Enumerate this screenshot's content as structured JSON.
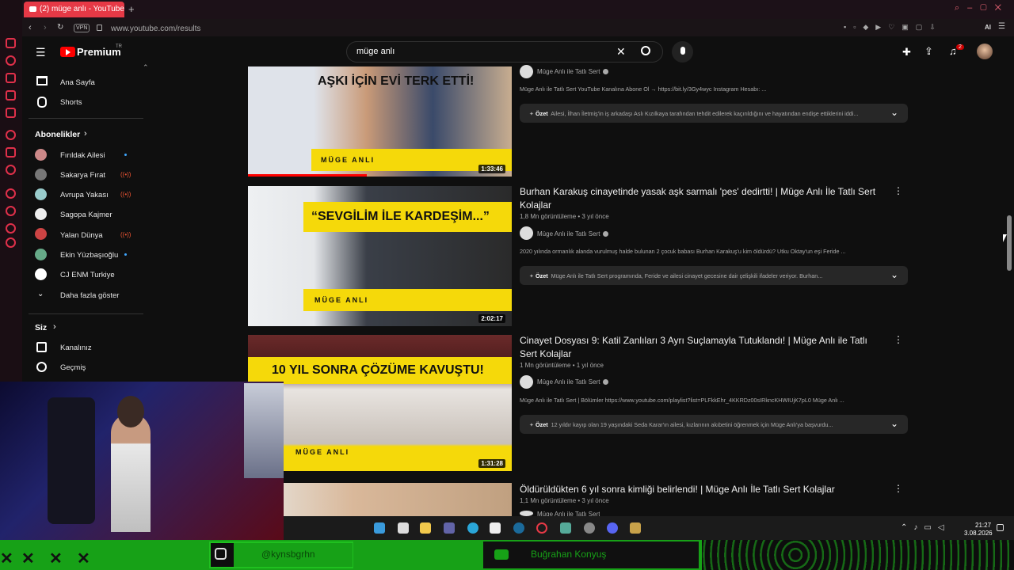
{
  "browser": {
    "tab_title": "(2) müge anlı - YouTube",
    "url": "www.youtube.com/results",
    "vpn": "VPN",
    "ai": "AI"
  },
  "yt": {
    "logo": "Premium",
    "logo_sup": "TR",
    "search_query": "müge anlı",
    "notif_count": "2"
  },
  "sidebar": {
    "nav": [
      {
        "label": "Ana Sayfa"
      },
      {
        "label": "Shorts"
      }
    ],
    "subs_title": "Abonelikler",
    "subs": [
      {
        "label": "Fırıldak Ailesi"
      },
      {
        "label": "Sakarya Fırat"
      },
      {
        "label": "Avrupa Yakası"
      },
      {
        "label": "Sagopa Kajmer"
      },
      {
        "label": "Yalan Dünya"
      },
      {
        "label": "Ekin Yüzbaşıoğlu"
      },
      {
        "label": "CJ ENM Turkiye"
      }
    ],
    "more": "Daha fazla göster",
    "you_title": "Siz",
    "you": [
      {
        "label": "Kanalınız"
      },
      {
        "label": "Geçmiş"
      }
    ]
  },
  "videos": [
    {
      "thumb_text": "AŞKI İÇİN EVİ TERK ETTİ!",
      "thumb_band": "MÜGE ANLI",
      "duration": "1:33:46",
      "channel": "Müge Anlı ile Tatlı Sert",
      "desc": "Müge Anlı ile Tatlı Sert YouTube Kanalına Abone Ol → https://bit.ly/3Gy4wyc Instagram Hesabı: ...",
      "summary_label": "Özet",
      "summary": "Ailesi, İlhan İletmiş'in iş arkadaşı Aslı Kızılkaya tarafından tehdit edilerek kaçırıldığını ve hayatından endişe ettiklerini iddi..."
    },
    {
      "title": "Burhan Karakuş cinayetinde yasak aşk sarmalı 'pes' dedirtti! | Müge Anlı İle Tatlı Sert Kolajlar",
      "meta": "1,8 Mn görüntüleme • 3 yıl önce",
      "thumb_text": "“SEVGİLİM İLE KARDEŞİM...”",
      "thumb_band": "MÜGE ANLI",
      "duration": "2:02:17",
      "channel": "Müge Anlı ile Tatlı Sert",
      "desc": "2020 yılında ormanlık alanda vurulmuş halde bulunan 2 çocuk babası Burhan Karakuş'u kim öldürdü? Utku Oktay'un eşi Feride ...",
      "summary_label": "Özet",
      "summary": "Müge Anlı ile Tatlı Sert programında, Feride ve ailesi cinayet gecesine dair çelişkili ifadeler veriyor. Burhan..."
    },
    {
      "title": "Cinayet Dosyası 9: Katil Zanlıları 3 Ayrı Suçlamayla Tutuklandı! | Müge Anlı ile Tatlı Sert Kolajlar",
      "meta": "1 Mn görüntüleme • 1 yıl önce",
      "thumb_text": "10 YIL SONRA ÇÖZÜME KAVUŞTU!",
      "thumb_band": "MÜGE ANLI",
      "duration": "1:31:28",
      "channel": "Müge Anlı ile Tatlı Sert",
      "desc": "Müge Anlı ile Tatlı Sert | Bölümler https://www.youtube.com/playlist?list=PLFkkEhr_4KKRDz00sIRkncKHWIUjK7pL0 Müge Anlı ...",
      "summary_label": "Özet",
      "summary": "12 yıldır kayıp olan 19 yaşındaki Seda Karar'ın ailesi, kızlarının akıbetini öğrenmek için Müge Anlı'ya başvurdu..."
    },
    {
      "title": "Öldürüldükten 6 yıl sonra kimliği belirlendi! | Müge Anlı İle Tatlı Sert Kolajlar",
      "meta": "1,1 Mn görüntüleme • 3 yıl önce",
      "channel": "Müge Anlı ile Tatlı Sert"
    }
  ],
  "taskbar": {
    "time": "21:27",
    "date": "3.08.2026"
  },
  "overlay": {
    "instagram": "@kynsbgrhn",
    "youtube": "Buğrahan Konyuş"
  },
  "colors": {
    "accent": "#e63946",
    "yt_red": "#ff0000",
    "thumb_yellow": "#f5d90a",
    "stream_green": "#17a117"
  }
}
